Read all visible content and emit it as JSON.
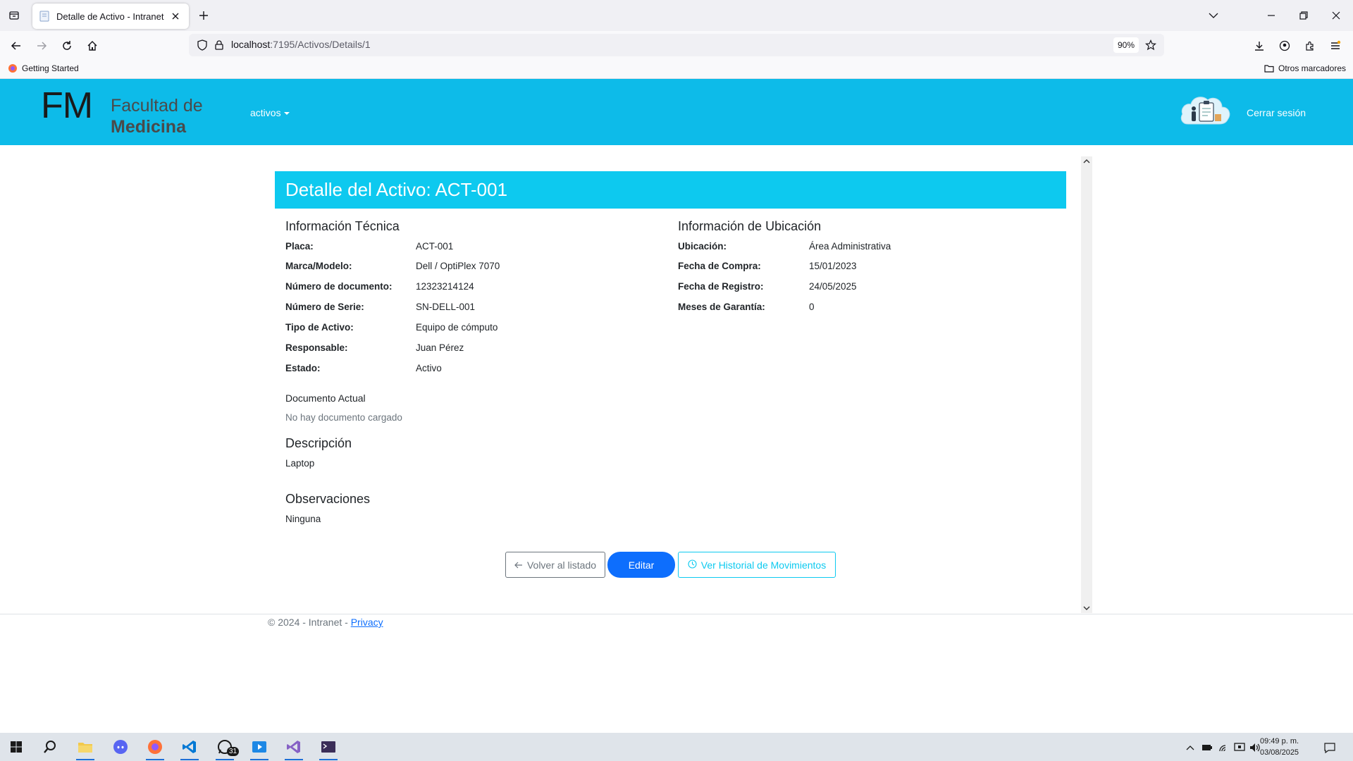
{
  "browser": {
    "tab_title": "Detalle de Activo - Intranet",
    "url_host": "localhost",
    "url_path": ":7195/Activos/Details/1",
    "zoom": "90%",
    "bookmark_getting_started": "Getting Started",
    "bookmark_others": "Otros marcadores"
  },
  "header": {
    "logo_letters": "FM",
    "logo_line1": "Facultad de",
    "logo_line2": "Medicina",
    "nav_activos": "activos",
    "logout": "Cerrar sesión"
  },
  "detail": {
    "title": "Detalle del Activo: ACT-001",
    "tech_section": "Información Técnica",
    "location_section": "Información de Ubicación",
    "tech": [
      {
        "label": "Placa:",
        "value": "ACT-001"
      },
      {
        "label": "Marca/Modelo:",
        "value": "Dell / OptiPlex 7070"
      },
      {
        "label": "Número de documento:",
        "value": "12323214124"
      },
      {
        "label": "Número de Serie:",
        "value": "SN-DELL-001"
      },
      {
        "label": "Tipo de Activo:",
        "value": "Equipo de cómputo"
      },
      {
        "label": "Responsable:",
        "value": "Juan Pérez"
      },
      {
        "label": "Estado:",
        "value": "Activo"
      }
    ],
    "location": [
      {
        "label": "Ubicación:",
        "value": "Área Administrativa"
      },
      {
        "label": "Fecha de Compra:",
        "value": "15/01/2023"
      },
      {
        "label": "Fecha de Registro:",
        "value": "24/05/2025"
      },
      {
        "label": "Meses de Garantía:",
        "value": "0"
      }
    ],
    "document_heading": "Documento Actual",
    "document_status": "No hay documento cargado",
    "description_heading": "Descripción",
    "description_value": "Laptop",
    "observations_heading": "Observaciones",
    "observations_value": "Ninguna"
  },
  "actions": {
    "back_label": "Volver al listado",
    "edit_label": "Editar",
    "history_label": "Ver Historial de Movimientos"
  },
  "footer": {
    "copyright": "© 2024 - Intranet - ",
    "privacy": "Privacy"
  },
  "taskbar": {
    "time": "09:49 p. m.",
    "date": "03/08/2025",
    "whatsapp_badge": "31"
  },
  "colors": {
    "header_bg": "#0dbbe9",
    "card_header_bg": "#0dc9ef",
    "primary": "#0d6efd",
    "info": "#0dcaf0"
  }
}
